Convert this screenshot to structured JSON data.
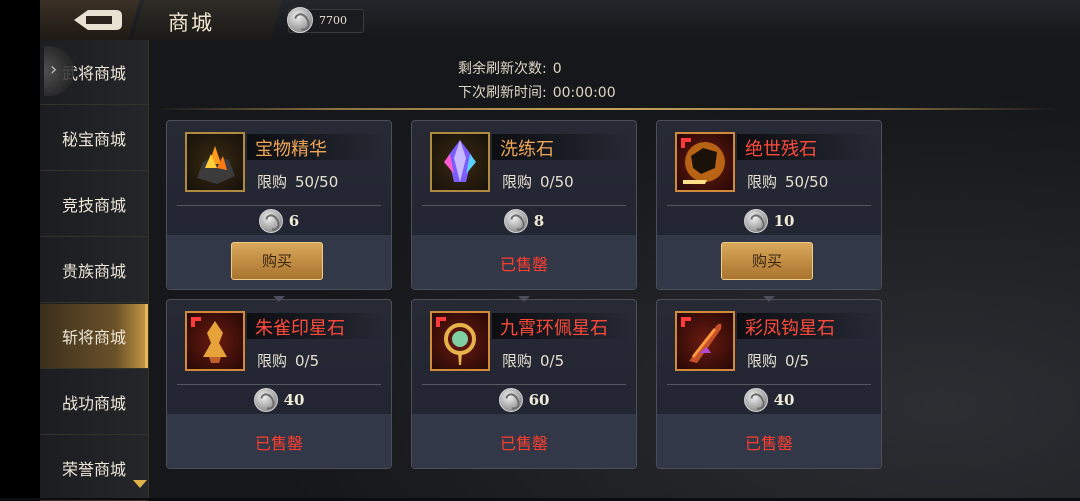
{
  "header": {
    "title": "商城",
    "currency_value": "7700"
  },
  "sidebar": {
    "items": [
      {
        "label": "武将商城",
        "active": false
      },
      {
        "label": "秘宝商城",
        "active": false
      },
      {
        "label": "竞技商城",
        "active": false
      },
      {
        "label": "贵族商城",
        "active": false
      },
      {
        "label": "斩将商城",
        "active": true
      },
      {
        "label": "战功商城",
        "active": false
      },
      {
        "label": "荣誉商城",
        "active": false
      }
    ]
  },
  "refresh": {
    "remaining_label": "剩余刷新次数:",
    "remaining_value": "0",
    "next_label": "下次刷新时间:",
    "next_value": "00:00:00"
  },
  "cards": [
    {
      "name": "宝物精华",
      "limit_label": "限购",
      "limit": "50/50",
      "price": "6",
      "action": "购买",
      "status": "buy",
      "icon": "ore-icon"
    },
    {
      "name": "洗练石",
      "limit_label": "限购",
      "limit": "0/50",
      "price": "8",
      "action": "已售罄",
      "status": "sold",
      "icon": "crystal-icon"
    },
    {
      "name": "绝世残石",
      "limit_label": "限购",
      "limit": "50/50",
      "price": "10",
      "action": "购买",
      "status": "buy",
      "icon": "fragment-icon"
    },
    {
      "name": "朱雀印星石",
      "limit_label": "限购",
      "limit": "0/5",
      "price": "40",
      "action": "已售罄",
      "status": "sold",
      "icon": "phoenix-seal-icon"
    },
    {
      "name": "九霄环佩星石",
      "limit_label": "限购",
      "limit": "0/5",
      "price": "60",
      "action": "已售罄",
      "status": "sold",
      "icon": "jade-pendant-icon"
    },
    {
      "name": "彩凤钩星石",
      "limit_label": "限购",
      "limit": "0/5",
      "price": "40",
      "action": "已售罄",
      "status": "sold",
      "icon": "hook-icon"
    }
  ],
  "colors": {
    "accent_gold": "#c9a45c",
    "sold_red": "#ff3d2e",
    "name_orange": "#efa657",
    "name_red": "#ff4a3a"
  }
}
